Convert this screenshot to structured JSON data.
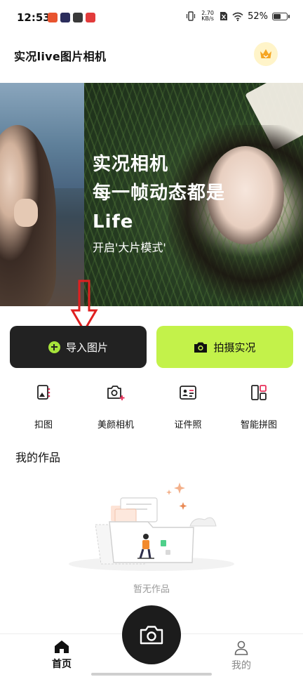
{
  "status_bar": {
    "time": "12:53",
    "net_speed_value": "2.70",
    "net_speed_unit": "KB/s",
    "battery": "52%",
    "battery_level": 0.52
  },
  "header": {
    "title": "实况live图片相机"
  },
  "banner": {
    "line1": "实况相机",
    "line2": "每一帧动态都是",
    "line3": "Life",
    "subtitle": "开启'大片模式'"
  },
  "actions": {
    "import_label": "导入图片",
    "shoot_label": "拍摄实况"
  },
  "tools": [
    {
      "label": "扣图",
      "icon": "cutout-icon"
    },
    {
      "label": "美颜相机",
      "icon": "beauty-camera-icon"
    },
    {
      "label": "证件照",
      "icon": "id-photo-icon"
    },
    {
      "label": "智能拼图",
      "icon": "collage-icon"
    }
  ],
  "works": {
    "section_title": "我的作品",
    "empty_text": "暂无作品"
  },
  "bottom_nav": {
    "home_label": "首页",
    "mine_label": "我的"
  },
  "colors": {
    "accent_green": "#c3f24a",
    "dark_button": "#222222",
    "annotation_red": "#e02020"
  }
}
